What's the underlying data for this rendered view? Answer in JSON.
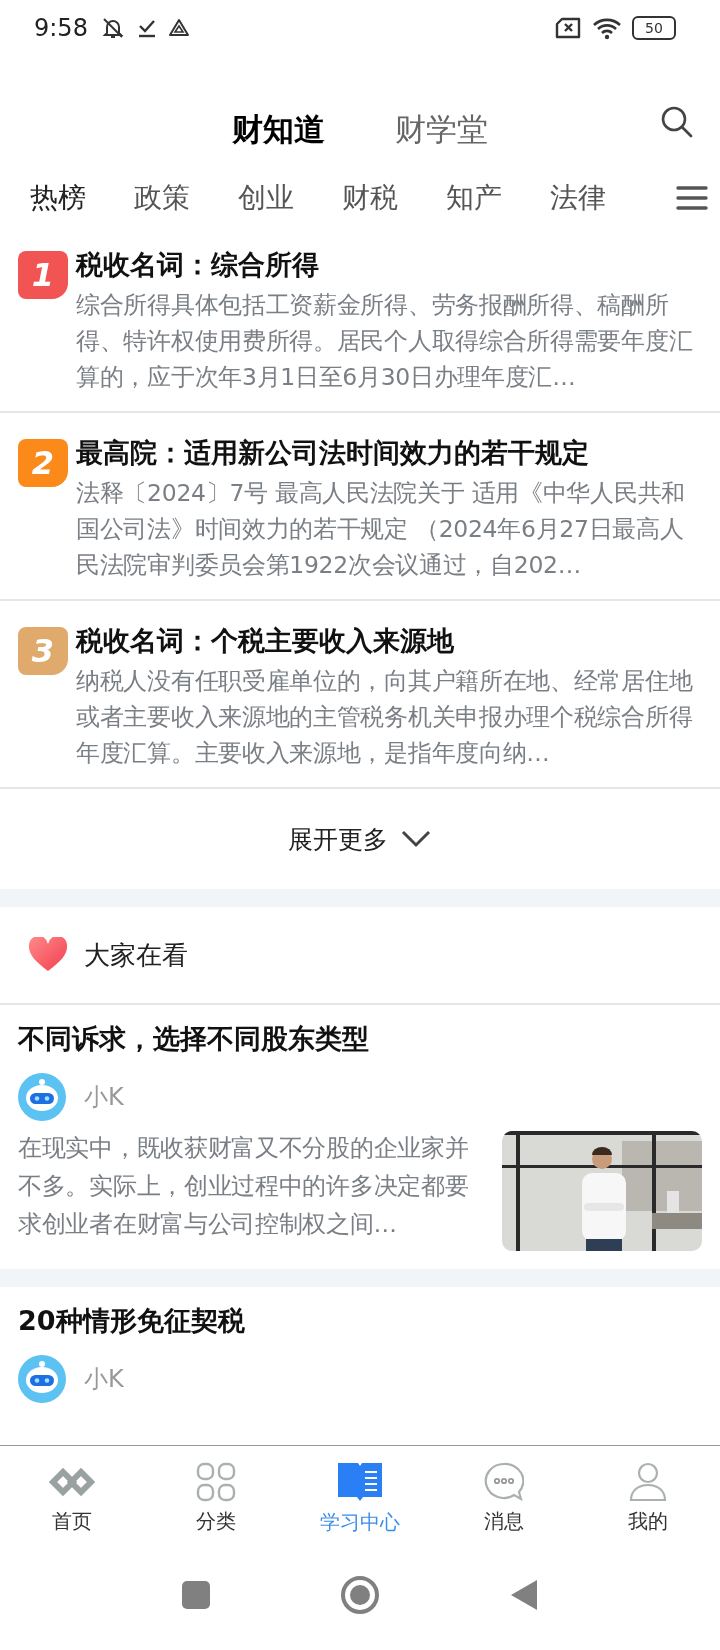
{
  "status_bar": {
    "time": "9:58",
    "battery": "50"
  },
  "header": {
    "tabs": [
      {
        "label": "财知道",
        "selected": true
      },
      {
        "label": "财学堂",
        "selected": false
      }
    ]
  },
  "categories": [
    {
      "label": "热榜",
      "selected": true
    },
    {
      "label": "政策",
      "selected": false
    },
    {
      "label": "创业",
      "selected": false
    },
    {
      "label": "财税",
      "selected": false
    },
    {
      "label": "知产",
      "selected": false
    },
    {
      "label": "法律",
      "selected": false
    }
  ],
  "hot_list": [
    {
      "rank": "1",
      "color": "#f25353",
      "title": "税收名词：综合所得",
      "summary": "综合所得具体包括工资薪金所得、劳务报酬所得、稿酬所得、特许权使用费所得。居民个人取得综合所得需要年度汇算的，应于次年3月1日至6月30日办理年度汇…"
    },
    {
      "rank": "2",
      "color": "#fb8a1b",
      "title": "最高院：适用新公司法时间效力的若干规定",
      "summary": "法释〔2024〕7号 最高人民法院关于 适用《中华人民共和国公司法》时间效力的若干规定 （2024年6月27日最高人民法院审判委员会第1922次会议通过，自202…"
    },
    {
      "rank": "3",
      "color": "#dfaa6c",
      "title": "税收名词：个税主要收入来源地",
      "summary": "纳税人没有任职受雇单位的，向其户籍所在地、经常居住地或者主要收入来源地的主管税务机关申报办理个税综合所得年度汇算。主要收入来源地，是指年度向纳…"
    }
  ],
  "expand_more": "展开更多",
  "feed": {
    "title": "大家在看",
    "articles": [
      {
        "title": "不同诉求，选择不同股东类型",
        "author": "小K",
        "summary": "在现实中，既收获财富又不分股的企业家并不多。实际上，创业过程中的许多决定都要求创业者在财富与公司控制权之间…"
      },
      {
        "title": "20种情形免征契税",
        "author": "小K"
      }
    ]
  },
  "bottom_nav": [
    {
      "label": "首页",
      "selected": false
    },
    {
      "label": "分类",
      "selected": false
    },
    {
      "label": "学习中心",
      "selected": true
    },
    {
      "label": "消息",
      "selected": false
    },
    {
      "label": "我的",
      "selected": false
    }
  ]
}
